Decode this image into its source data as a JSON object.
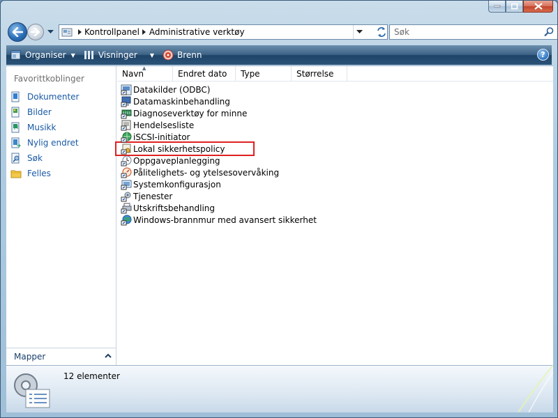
{
  "window": {
    "caption_buttons": {
      "minimize": "minimize",
      "maximize": "maximize",
      "close": "close"
    }
  },
  "navigation": {
    "breadcrumbs": [
      "Kontrollpanel",
      "Administrative verktøy"
    ],
    "search_placeholder": "Søk"
  },
  "toolbar": {
    "organize": "Organiser",
    "views": "Visninger",
    "burn": "Brenn"
  },
  "sidebar": {
    "favorites_heading": "Favorittkoblinger",
    "items": [
      {
        "label": "Dokumenter",
        "icon": "documents-icon"
      },
      {
        "label": "Bilder",
        "icon": "pictures-icon"
      },
      {
        "label": "Musikk",
        "icon": "music-icon"
      },
      {
        "label": "Nylig endret",
        "icon": "recently-changed-icon"
      },
      {
        "label": "Søk",
        "icon": "searches-icon"
      },
      {
        "label": "Felles",
        "icon": "public-folder-icon"
      }
    ],
    "folders_label": "Mapper"
  },
  "columns": [
    "Navn",
    "Endret dato",
    "Type",
    "Størrelse"
  ],
  "files": [
    {
      "name": "Datakilder (ODBC)",
      "icon": "odbc-shortcut-icon"
    },
    {
      "name": "Datamaskinbehandling",
      "icon": "computer-management-shortcut-icon"
    },
    {
      "name": "Diagnoseverktøy for minne",
      "icon": "memory-diagnostic-shortcut-icon"
    },
    {
      "name": "Hendelsesliste",
      "icon": "event-viewer-shortcut-icon"
    },
    {
      "name": "iSCSI-initiator",
      "icon": "iscsi-shortcut-icon"
    },
    {
      "name": "Lokal sikkerhetspolicy",
      "icon": "security-policy-shortcut-icon",
      "highlighted": true
    },
    {
      "name": "Oppgaveplanlegging",
      "icon": "task-scheduler-shortcut-icon"
    },
    {
      "name": "Pålitelighets- og ytelsesovervåking",
      "icon": "reliability-monitor-shortcut-icon"
    },
    {
      "name": "Systemkonfigurasjon",
      "icon": "system-configuration-shortcut-icon"
    },
    {
      "name": "Tjenester",
      "icon": "services-shortcut-icon"
    },
    {
      "name": "Utskriftsbehandling",
      "icon": "print-management-shortcut-icon"
    },
    {
      "name": "Windows-brannmur med avansert sikkerhet",
      "icon": "firewall-shortcut-icon"
    }
  ],
  "details": {
    "item_count": "12 elementer"
  },
  "colors": {
    "toolbar": "#2b5378",
    "link": "#1a5aa6",
    "highlight_box": "#e02020"
  }
}
